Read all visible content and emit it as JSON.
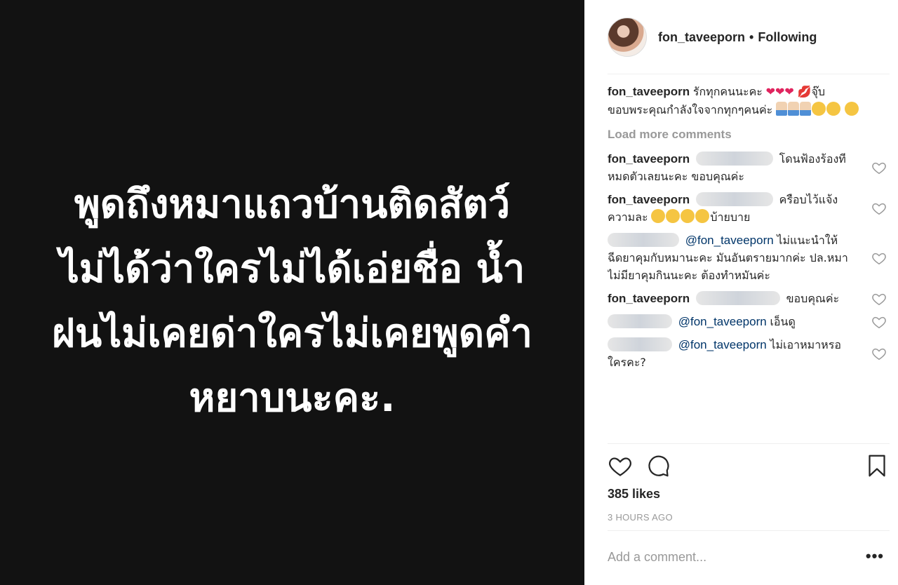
{
  "media": {
    "text": "พูดถึงหมาแถวบ้านติดสัตว์ ไม่ได้ว่าใครไม่ได้เอ่ยชื่อ น้ำฝนไม่เคยด่าใครไม่เคยพูดคำหยาบนะคะ."
  },
  "header": {
    "username": "fon_taveeporn",
    "dot": "•",
    "follow_status": "Following"
  },
  "caption": {
    "username": "fon_taveeporn",
    "text_1": "รักทุกคนนะคะ",
    "text_2": "จุ๊บ",
    "text_3": "ขอบพระคุณกำลังใจจากทุกๆคนค่ะ"
  },
  "load_more": "Load more comments",
  "comments": [
    {
      "username": "fon_taveeporn",
      "pre": "",
      "mention": "",
      "text": "โดนฟ้องร้องที หมดตัวเลยนะคะ ขอบคุณค่ะ"
    },
    {
      "username": "fon_taveeporn",
      "pre": "",
      "mention": "",
      "text": "ครือบไว้แจ้งความละ",
      "tail": "บ้ายบาย"
    },
    {
      "username": "",
      "pre": "",
      "mention": "@fon_taveeporn",
      "text": "ไม่แนะนำให้ฉีดยาคุมกับหมานะคะ มันอันตรายมากค่ะ ปล.หมาไม่มียาคุมกินนะคะ ต้องทำหมันค่ะ"
    },
    {
      "username": "fon_taveeporn",
      "pre": "",
      "mention": "",
      "text": "ขอบคุณค่ะ"
    },
    {
      "username": "",
      "pre": "",
      "mention": "@fon_taveeporn",
      "text": "เอ็นดู"
    },
    {
      "username": "",
      "pre": "",
      "mention": "@fon_taveeporn",
      "text": "ไม่เอาหมาหรอ ใครคะ?"
    }
  ],
  "likes": "385 likes",
  "time": "3 HOURS AGO",
  "add_comment_placeholder": "Add a comment...",
  "more_label": "•••",
  "icons": {
    "like": "heart-icon",
    "comment": "speech-bubble-icon",
    "save": "bookmark-icon"
  }
}
